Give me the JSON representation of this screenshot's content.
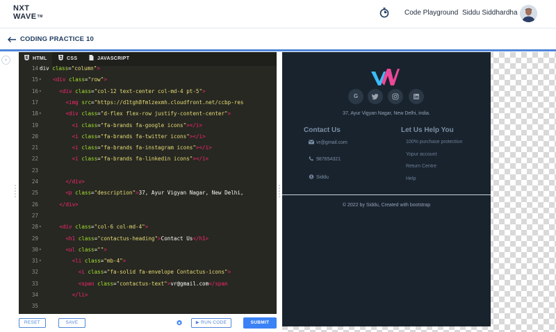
{
  "header": {
    "logo_line1": "NXT",
    "logo_line2": "WAVE",
    "logo_tm": "TM",
    "playground_label": "Code Playground",
    "user_name": "Siddu Siddhardha"
  },
  "subheader": {
    "title": "CODING PRACTICE 10"
  },
  "editor": {
    "tabs": [
      {
        "label": "HTML",
        "active": true
      },
      {
        "label": "CSS",
        "active": false
      },
      {
        "label": "JAVASCRIPT",
        "active": false
      }
    ],
    "lines": [
      {
        "num": "14",
        "fold": "▾",
        "text": "div class=\"column\">"
      },
      {
        "num": "15",
        "fold": "▾",
        "text": "  <div class=\"row\">"
      },
      {
        "num": "16",
        "fold": "▾",
        "text": "    <div class=\"col-12 text-center col-md-4 pt-5\">"
      },
      {
        "num": "17",
        "fold": "",
        "text": "      <img src=\"https://d1tgh8fmlzexmh.cloudfront.net/ccbp-res"
      },
      {
        "num": "18",
        "fold": "▾",
        "text": "      <div class=\"d-flex flex-row justify-content-center\">"
      },
      {
        "num": "19",
        "fold": "",
        "text": "        <i class=\"fa-brands fa-google icons\"></i>"
      },
      {
        "num": "20",
        "fold": "",
        "text": "        <i class=\"fa-brands fa-twitter icons\"></i>"
      },
      {
        "num": "21",
        "fold": "",
        "text": "        <i class=\"fa-brands fa-instagram icons\"></i>"
      },
      {
        "num": "22",
        "fold": "",
        "text": "        <i class=\"fa-brands fa-linkedin icons\"></i>"
      },
      {
        "num": "23",
        "fold": "",
        "text": ""
      },
      {
        "num": "24",
        "fold": "",
        "text": "      </div>"
      },
      {
        "num": "25",
        "fold": "",
        "text": "      <p class=\"description\">37, Ayur Vigyan Nagar, New Delhi,"
      },
      {
        "num": "26",
        "fold": "",
        "text": "    </div>"
      },
      {
        "num": "27",
        "fold": "",
        "text": ""
      },
      {
        "num": "28",
        "fold": "▾",
        "text": "    <div class=\"col-6 col-md-4\">"
      },
      {
        "num": "29",
        "fold": "",
        "text": "      <h1 class=\"contactus-heading\">Contact Us</h1>"
      },
      {
        "num": "30",
        "fold": "▾",
        "text": "      <ul class=\"\">"
      },
      {
        "num": "31",
        "fold": "▾",
        "text": "        <li class=\"mb-4\">"
      },
      {
        "num": "32",
        "fold": "",
        "text": "          <i class=\"fa-solid fa-envelope Contactus-icons\">"
      },
      {
        "num": "33",
        "fold": "",
        "text": "          <span class=\"contactus-text\">vr@gmail.com</span"
      },
      {
        "num": "34",
        "fold": "",
        "text": "        </li>"
      },
      {
        "num": "35",
        "fold": "",
        "text": ""
      }
    ]
  },
  "actions": {
    "reset": "RESET",
    "save": "SAVE",
    "run": "RUN CODE",
    "submit": "SUBMIT"
  },
  "preview": {
    "social": [
      "G",
      "t",
      "i",
      "in"
    ],
    "address": "37, Ayur Vigyan Nagar, New Delhi, india.",
    "contact_heading": "Contact Us",
    "contact_items": [
      "vr@gmail.com",
      "987654321",
      "Siddu"
    ],
    "help_heading": "Let Us Help You",
    "help_items": [
      "100% purchase protection",
      "Yopur account",
      "Return Centre",
      "Help"
    ],
    "copyright": "© 2022 by Siddu, Created with bootstrap"
  },
  "colors": {
    "accent": "#4f86d9",
    "submit_bg": "#3b82f6",
    "editor_bg": "#272822",
    "preview_bg": "#19232e"
  }
}
